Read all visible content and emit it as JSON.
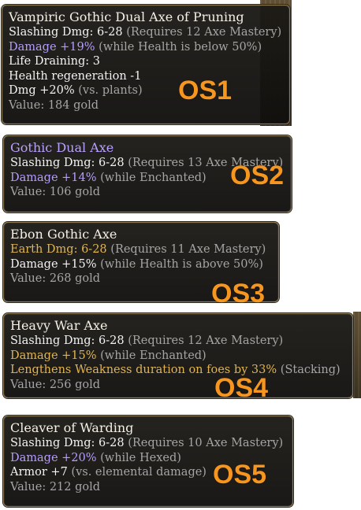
{
  "items": [
    {
      "tag": "OS1",
      "name": "Vampiric Gothic Dual Axe of Pruning",
      "damage_line": "Slashing Dmg: 6-28",
      "requirement": "(Requires 12 Axe Mastery)",
      "mods": [
        {
          "main": "Damage +19%",
          "note": "(while Health is below 50%)"
        },
        {
          "main": "Life Draining: 3",
          "note": ""
        },
        {
          "main": "Health regeneration -1",
          "note": ""
        },
        {
          "main": "Dmg +20%",
          "note": "(vs. plants)"
        }
      ],
      "value": "Value: 184 gold"
    },
    {
      "tag": "OS2",
      "name": "Gothic Dual Axe",
      "damage_line": "Slashing Dmg: 6-28",
      "requirement": "(Requires 13 Axe Mastery)",
      "mods": [
        {
          "main": "Damage +14%",
          "note": "(while Enchanted)"
        }
      ],
      "value": "Value: 106 gold"
    },
    {
      "tag": "OS3",
      "name": "Ebon Gothic Axe",
      "damage_line": "Earth Dmg: 6-28",
      "requirement": "(Requires 11 Axe Mastery)",
      "mods": [
        {
          "main": "Damage +15%",
          "note": "(while Health is above 50%)"
        }
      ],
      "value": "Value: 268 gold"
    },
    {
      "tag": "OS4",
      "name": "Heavy War Axe",
      "damage_line": "Slashing Dmg: 6-28",
      "requirement": "(Requires 12 Axe Mastery)",
      "mods": [
        {
          "main": "Damage +15%",
          "note": "(while Enchanted)"
        },
        {
          "main": "Lengthens Weakness duration on foes by 33%",
          "note": "(Stacking)"
        }
      ],
      "value": "Value: 256 gold"
    },
    {
      "tag": "OS5",
      "name": "Cleaver of Warding",
      "damage_line": "Slashing Dmg: 6-28",
      "requirement": "(Requires 10 Axe Mastery)",
      "mods": [
        {
          "main": "Damage +20%",
          "note": "(while Hexed)"
        },
        {
          "main": "Armor +7",
          "note": "(vs. elemental damage)"
        }
      ],
      "value": "Value: 212 gold"
    }
  ],
  "colors": {
    "label_orange": "#f7961e",
    "title_white": "#f4f0e6",
    "title_purple": "#b9a0ff",
    "mod_purple": "#b59cff",
    "mod_gold": "#e0b452",
    "note_grey": "#a5a5a5"
  }
}
